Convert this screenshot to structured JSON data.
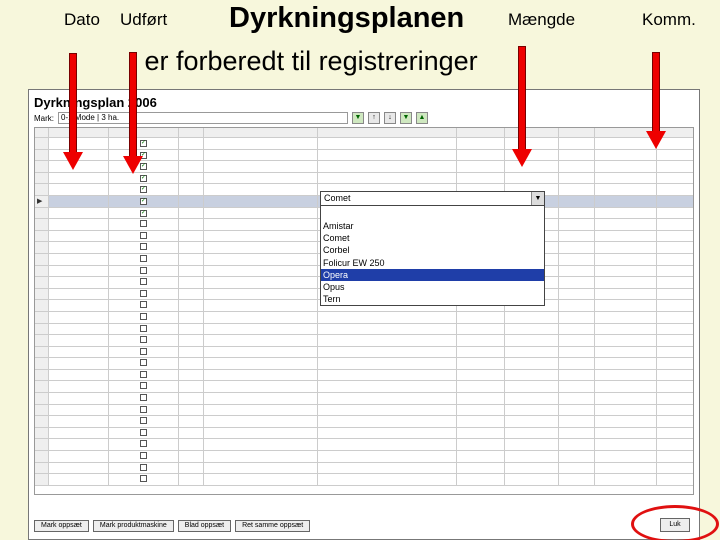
{
  "labels": {
    "dato": "Dato",
    "udfort": "Udført",
    "maengde": "Mængde",
    "komm": "Komm."
  },
  "title": "Dyrkningsplanen",
  "subtitle": "- er forberedt til registreringer",
  "app": {
    "title": "Dyrkningsplan 2006",
    "filter_label": "Mark:",
    "filter_value": "0-1 Mode | 3 ha."
  },
  "dropdown": {
    "current": "Comet",
    "options": [
      "Amistar",
      "Comet",
      "Corbel",
      "Folicur EW 250",
      "Opera",
      "Opus",
      "Tern"
    ],
    "highlighted": "Opera"
  },
  "footer": {
    "buttons": [
      "Mark oppsæt",
      "Mark produktmaskine",
      "Blad oppsæt",
      "Ret samme oppsæt"
    ],
    "close": "Luk"
  },
  "colors": {
    "annotation": "#e00000",
    "background": "#f7f7dc"
  }
}
